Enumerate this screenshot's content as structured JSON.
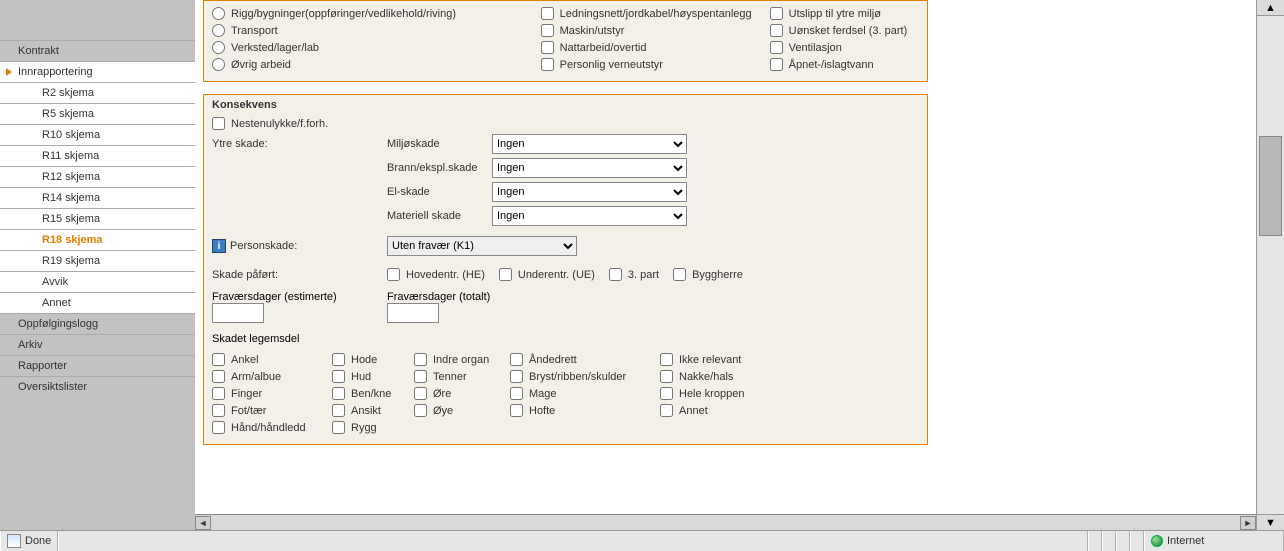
{
  "sidebar": {
    "items": [
      {
        "label": "Kontrakt",
        "cls": "top-level"
      },
      {
        "label": "Innrapportering",
        "cls": "top-level active-parent"
      },
      {
        "label": "R2 skjema",
        "cls": "sub"
      },
      {
        "label": "R5 skjema",
        "cls": "sub"
      },
      {
        "label": "R10 skjema",
        "cls": "sub"
      },
      {
        "label": "R11 skjema",
        "cls": "sub"
      },
      {
        "label": "R12 skjema",
        "cls": "sub"
      },
      {
        "label": "R14 skjema",
        "cls": "sub"
      },
      {
        "label": "R15 skjema",
        "cls": "sub"
      },
      {
        "label": "R18 skjema",
        "cls": "sub active"
      },
      {
        "label": "R19 skjema",
        "cls": "sub"
      },
      {
        "label": "Avvik",
        "cls": "sub"
      },
      {
        "label": "Annet",
        "cls": "sub"
      },
      {
        "label": "Oppfølgingslogg",
        "cls": "top-level"
      },
      {
        "label": "Arkiv",
        "cls": "top-level"
      },
      {
        "label": "Rapporter",
        "cls": "top-level"
      },
      {
        "label": "Oversiktslister",
        "cls": "top-level"
      }
    ]
  },
  "panel1": {
    "radios": [
      "Rigg/bygninger(oppføringer/vedlikehold/riving)",
      "Transport",
      "Verksted/lager/lab",
      "Øvrig arbeid"
    ],
    "chk_colB": [
      "Ledningsnett/jordkabel/høyspentanlegg",
      "Maskin/utstyr",
      "Nattarbeid/overtid",
      "Personlig verneutstyr"
    ],
    "chk_colC": [
      "Utslipp til ytre miljø",
      "Uønsket ferdsel (3. part)",
      "Ventilasjon",
      "Åpnet-/islagtvann"
    ]
  },
  "panel2": {
    "title": "Konsekvens",
    "nesten": "Nestenulykke/f.forh.",
    "ytre": "Ytre skade:",
    "rows": [
      {
        "label": "Miljøskade",
        "value": "Ingen"
      },
      {
        "label": "Brann/ekspl.skade",
        "value": "Ingen"
      },
      {
        "label": "El-skade",
        "value": "Ingen"
      },
      {
        "label": "Materiell skade",
        "value": "Ingen"
      }
    ],
    "personskade_lbl": "Personskade:",
    "personskade_val": "Uten fravær (K1)",
    "skade_paafort": "Skade påført:",
    "paafort_opts": [
      "Hovedentr. (HE)",
      "Underentr. (UE)",
      "3. part",
      "Byggherre"
    ],
    "frav_est": "Fraværsdager (estimerte)",
    "frav_tot": "Fraværsdager (totalt)",
    "legemsdel_title": "Skadet legemsdel",
    "body_cols": [
      [
        "Ankel",
        "Arm/albue",
        "Finger",
        "Fot/tær",
        "Hånd/håndledd"
      ],
      [
        "Hode",
        "Hud",
        "Ben/kne",
        "Ansikt",
        "Rygg"
      ],
      [
        "Indre organ",
        "Tenner",
        "Øre",
        "Øye"
      ],
      [
        "Åndedrett",
        "Bryst/ribben/skulder",
        "Mage",
        "Hofte"
      ],
      [
        "Ikke relevant",
        "Nakke/hals",
        "Hele kroppen",
        "Annet"
      ]
    ]
  },
  "status": {
    "done": "Done",
    "internet": "Internet"
  }
}
